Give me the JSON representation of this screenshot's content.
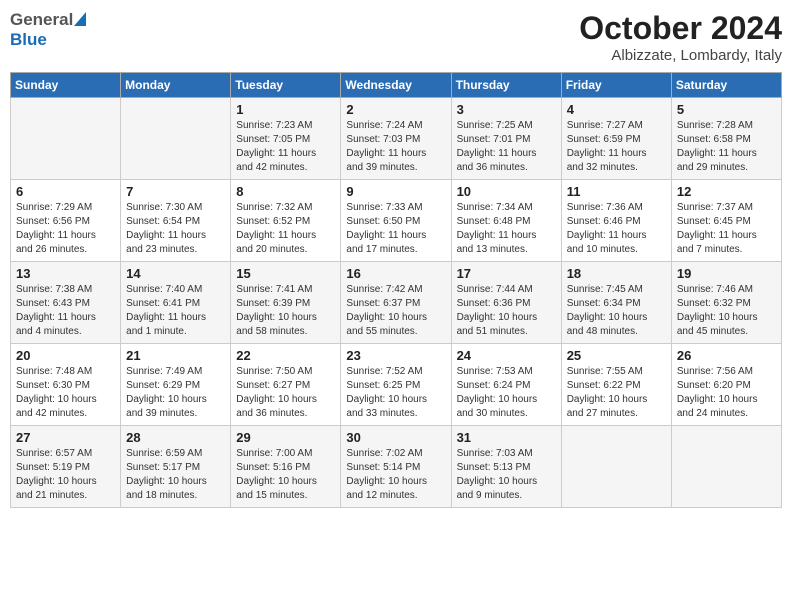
{
  "header": {
    "logo_general": "General",
    "logo_blue": "Blue",
    "month_title": "October 2024",
    "location": "Albizzate, Lombardy, Italy"
  },
  "columns": [
    "Sunday",
    "Monday",
    "Tuesday",
    "Wednesday",
    "Thursday",
    "Friday",
    "Saturday"
  ],
  "weeks": [
    [
      {
        "day": "",
        "info": ""
      },
      {
        "day": "",
        "info": ""
      },
      {
        "day": "1",
        "info": "Sunrise: 7:23 AM\nSunset: 7:05 PM\nDaylight: 11 hours and 42 minutes."
      },
      {
        "day": "2",
        "info": "Sunrise: 7:24 AM\nSunset: 7:03 PM\nDaylight: 11 hours and 39 minutes."
      },
      {
        "day": "3",
        "info": "Sunrise: 7:25 AM\nSunset: 7:01 PM\nDaylight: 11 hours and 36 minutes."
      },
      {
        "day": "4",
        "info": "Sunrise: 7:27 AM\nSunset: 6:59 PM\nDaylight: 11 hours and 32 minutes."
      },
      {
        "day": "5",
        "info": "Sunrise: 7:28 AM\nSunset: 6:58 PM\nDaylight: 11 hours and 29 minutes."
      }
    ],
    [
      {
        "day": "6",
        "info": "Sunrise: 7:29 AM\nSunset: 6:56 PM\nDaylight: 11 hours and 26 minutes."
      },
      {
        "day": "7",
        "info": "Sunrise: 7:30 AM\nSunset: 6:54 PM\nDaylight: 11 hours and 23 minutes."
      },
      {
        "day": "8",
        "info": "Sunrise: 7:32 AM\nSunset: 6:52 PM\nDaylight: 11 hours and 20 minutes."
      },
      {
        "day": "9",
        "info": "Sunrise: 7:33 AM\nSunset: 6:50 PM\nDaylight: 11 hours and 17 minutes."
      },
      {
        "day": "10",
        "info": "Sunrise: 7:34 AM\nSunset: 6:48 PM\nDaylight: 11 hours and 13 minutes."
      },
      {
        "day": "11",
        "info": "Sunrise: 7:36 AM\nSunset: 6:46 PM\nDaylight: 11 hours and 10 minutes."
      },
      {
        "day": "12",
        "info": "Sunrise: 7:37 AM\nSunset: 6:45 PM\nDaylight: 11 hours and 7 minutes."
      }
    ],
    [
      {
        "day": "13",
        "info": "Sunrise: 7:38 AM\nSunset: 6:43 PM\nDaylight: 11 hours and 4 minutes."
      },
      {
        "day": "14",
        "info": "Sunrise: 7:40 AM\nSunset: 6:41 PM\nDaylight: 11 hours and 1 minute."
      },
      {
        "day": "15",
        "info": "Sunrise: 7:41 AM\nSunset: 6:39 PM\nDaylight: 10 hours and 58 minutes."
      },
      {
        "day": "16",
        "info": "Sunrise: 7:42 AM\nSunset: 6:37 PM\nDaylight: 10 hours and 55 minutes."
      },
      {
        "day": "17",
        "info": "Sunrise: 7:44 AM\nSunset: 6:36 PM\nDaylight: 10 hours and 51 minutes."
      },
      {
        "day": "18",
        "info": "Sunrise: 7:45 AM\nSunset: 6:34 PM\nDaylight: 10 hours and 48 minutes."
      },
      {
        "day": "19",
        "info": "Sunrise: 7:46 AM\nSunset: 6:32 PM\nDaylight: 10 hours and 45 minutes."
      }
    ],
    [
      {
        "day": "20",
        "info": "Sunrise: 7:48 AM\nSunset: 6:30 PM\nDaylight: 10 hours and 42 minutes."
      },
      {
        "day": "21",
        "info": "Sunrise: 7:49 AM\nSunset: 6:29 PM\nDaylight: 10 hours and 39 minutes."
      },
      {
        "day": "22",
        "info": "Sunrise: 7:50 AM\nSunset: 6:27 PM\nDaylight: 10 hours and 36 minutes."
      },
      {
        "day": "23",
        "info": "Sunrise: 7:52 AM\nSunset: 6:25 PM\nDaylight: 10 hours and 33 minutes."
      },
      {
        "day": "24",
        "info": "Sunrise: 7:53 AM\nSunset: 6:24 PM\nDaylight: 10 hours and 30 minutes."
      },
      {
        "day": "25",
        "info": "Sunrise: 7:55 AM\nSunset: 6:22 PM\nDaylight: 10 hours and 27 minutes."
      },
      {
        "day": "26",
        "info": "Sunrise: 7:56 AM\nSunset: 6:20 PM\nDaylight: 10 hours and 24 minutes."
      }
    ],
    [
      {
        "day": "27",
        "info": "Sunrise: 6:57 AM\nSunset: 5:19 PM\nDaylight: 10 hours and 21 minutes."
      },
      {
        "day": "28",
        "info": "Sunrise: 6:59 AM\nSunset: 5:17 PM\nDaylight: 10 hours and 18 minutes."
      },
      {
        "day": "29",
        "info": "Sunrise: 7:00 AM\nSunset: 5:16 PM\nDaylight: 10 hours and 15 minutes."
      },
      {
        "day": "30",
        "info": "Sunrise: 7:02 AM\nSunset: 5:14 PM\nDaylight: 10 hours and 12 minutes."
      },
      {
        "day": "31",
        "info": "Sunrise: 7:03 AM\nSunset: 5:13 PM\nDaylight: 10 hours and 9 minutes."
      },
      {
        "day": "",
        "info": ""
      },
      {
        "day": "",
        "info": ""
      }
    ]
  ]
}
